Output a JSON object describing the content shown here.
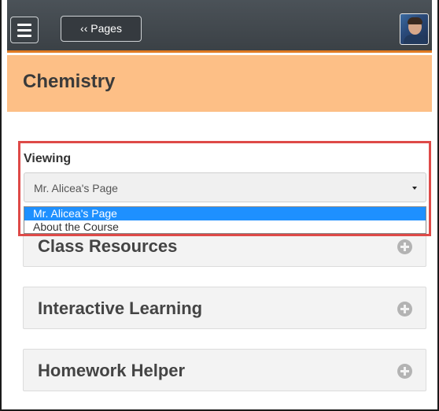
{
  "header": {
    "pages_button_label": "‹‹ Pages",
    "accent_color": "#e07a22"
  },
  "course": {
    "title": "Chemistry",
    "band_color": "#fdbf86"
  },
  "viewing": {
    "label": "Viewing",
    "selected_value": "Mr. Alicea's Page",
    "options": [
      "Mr. Alicea's Page",
      "About the Course"
    ],
    "highlight_color": "#de4a48"
  },
  "sections": [
    {
      "label": "Class Resources"
    },
    {
      "label": "Interactive Learning"
    },
    {
      "label": "Homework Helper"
    }
  ]
}
